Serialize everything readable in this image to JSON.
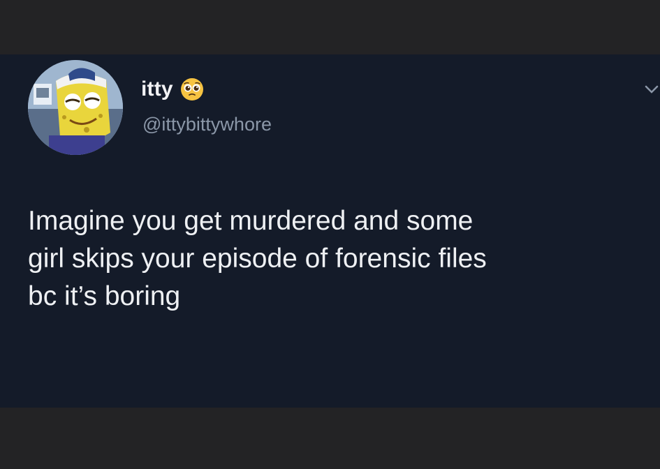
{
  "tweet": {
    "display_name": "itty",
    "name_emoji": "pleading-face-emoji",
    "handle": "@ittybittywhore",
    "text": "Imagine you get murdered and some\ngirl skips your episode of forensic files\nbc it’s boring",
    "avatar": "spongebob-avatar",
    "menu_icon": "chevron-down-icon"
  },
  "colors": {
    "outer_background": "#232325",
    "tweet_background": "#141b29",
    "name_text": "#f2f2f4",
    "handle_text": "#8b97a8",
    "body_text": "#eef0f3"
  }
}
